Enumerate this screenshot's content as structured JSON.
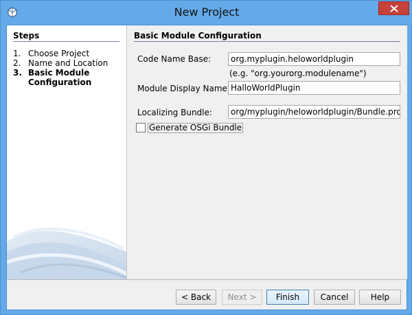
{
  "window": {
    "title": "New Project"
  },
  "steps": {
    "heading": "Steps",
    "items": [
      {
        "num": "1.",
        "label": "Choose Project",
        "active": false
      },
      {
        "num": "2.",
        "label": "Name and Location",
        "active": false
      },
      {
        "num": "3.",
        "label": "Basic Module Configuration",
        "active": true
      }
    ]
  },
  "panel": {
    "heading": "Basic Module Configuration",
    "code_name_base": {
      "label": "Code Name Base:",
      "value": "org.myplugin.heloworldplugin",
      "hint": "(e.g. \"org.yourorg.modulename\")"
    },
    "display_name": {
      "label": "Module Display Name:",
      "value": "HalloWorldPlugin"
    },
    "localizing_bundle": {
      "label": "Localizing Bundle:",
      "value": "org/myplugin/heloworldplugin/Bundle.properties"
    },
    "osgi": {
      "label": "Generate OSGi Bundle",
      "checked": false
    }
  },
  "buttons": {
    "back": "< Back",
    "next": "Next >",
    "finish": "Finish",
    "cancel": "Cancel",
    "help": "Help"
  },
  "colors": {
    "titlebar": "#64a9e8",
    "close": "#c7413b",
    "rule": "#6f7f96"
  },
  "icons": {
    "app": "coffee-cup-icon",
    "close": "close-icon"
  }
}
